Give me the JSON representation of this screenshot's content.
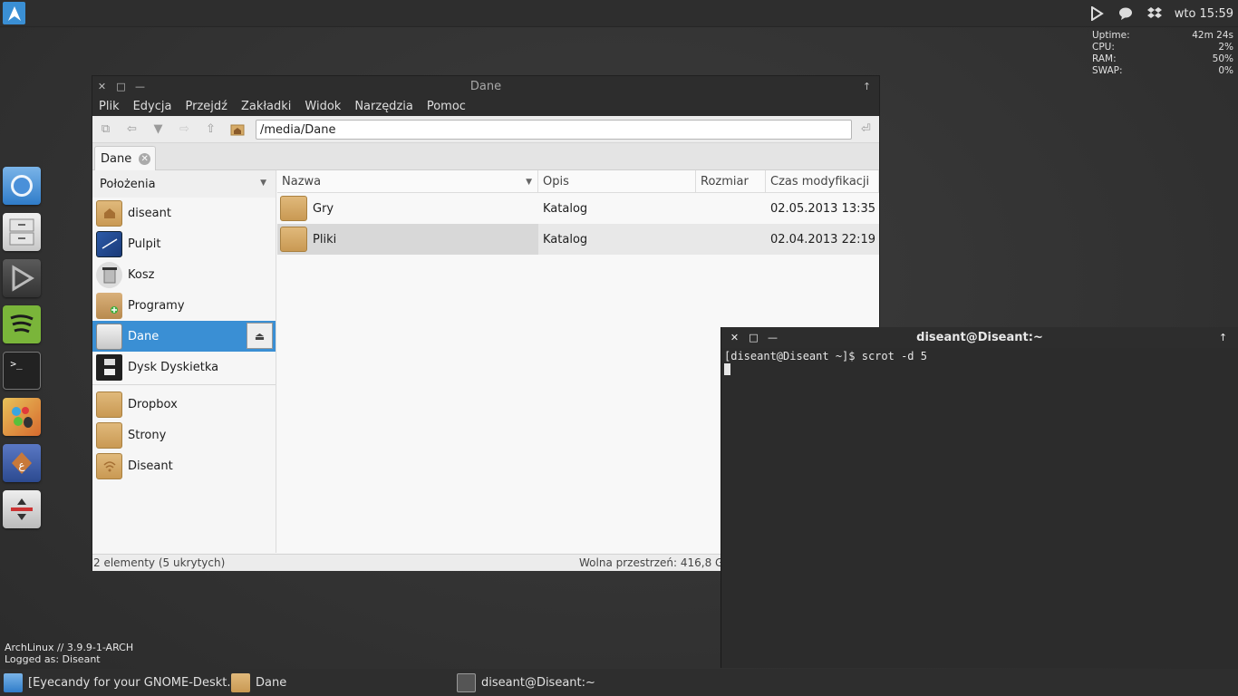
{
  "top_panel": {
    "clock": "wto 15:59",
    "tray_icons": [
      "play-icon",
      "chat-bubble-icon",
      "dropbox-icon"
    ]
  },
  "conky": [
    {
      "label": "Uptime:",
      "value": "42m 24s"
    },
    {
      "label": "CPU:",
      "value": "2%"
    },
    {
      "label": "RAM:",
      "value": "50%"
    },
    {
      "label": "SWAP:",
      "value": "0%"
    }
  ],
  "sysinfo": {
    "line1": "ArchLinux // 3.9.9-1-ARCH",
    "line2": "Logged as: Diseant"
  },
  "dock": [
    "chromium-icon",
    "file-cabinet-icon",
    "player-icon",
    "spotify-icon",
    "terminal-icon",
    "paint-icon",
    "arabic-app-icon",
    "tool-icon"
  ],
  "file_manager": {
    "title": "Dane",
    "menu": [
      "Plik",
      "Edycja",
      "Przejdź",
      "Zakładki",
      "Widok",
      "Narzędzia",
      "Pomoc"
    ],
    "path": "/media/Dane",
    "tab_label": "Dane",
    "sidebar_header": "Położenia",
    "places": [
      {
        "label": "diseant",
        "icon": "home-folder-icon"
      },
      {
        "label": "Pulpit",
        "icon": "desktop-icon"
      },
      {
        "label": "Kosz",
        "icon": "trash-icon"
      },
      {
        "label": "Programy",
        "icon": "package-icon"
      },
      {
        "label": "Dane",
        "icon": "drive-icon"
      },
      {
        "label": "Dysk Dyskietka",
        "icon": "floppy-icon"
      }
    ],
    "bookmarks": [
      {
        "label": "Dropbox",
        "icon": "folder-icon"
      },
      {
        "label": "Strony",
        "icon": "folder-icon"
      },
      {
        "label": "Diseant",
        "icon": "network-folder-icon"
      }
    ],
    "columns": [
      "Nazwa",
      "Opis",
      "Rozmiar",
      "Czas modyfikacji"
    ],
    "rows": [
      {
        "name": "Gry",
        "desc": "Katalog",
        "size": "",
        "modified": "02.05.2013 13:35"
      },
      {
        "name": "Pliki",
        "desc": "Katalog",
        "size": "",
        "modified": "02.04.2013 22:19"
      }
    ],
    "status_left": "2 elementy (5 ukrytych)",
    "status_right": "Wolna przestrzeń: 416,8 G"
  },
  "terminal": {
    "title": "diseant@Diseant:~",
    "line1": "[diseant@Diseant ~]$ scrot -d 5"
  },
  "taskbar": [
    {
      "label": "[Eyecandy for your GNOME-Deskt...",
      "icon": "chromium-icon"
    },
    {
      "label": "Dane",
      "icon": "folder-icon"
    },
    {
      "label": "diseant@Diseant:~",
      "icon": "monitor-icon"
    }
  ],
  "colors": {
    "accent": "#3a8fd4",
    "panel": "#2e2e2e",
    "folder": "#d6ab68"
  }
}
